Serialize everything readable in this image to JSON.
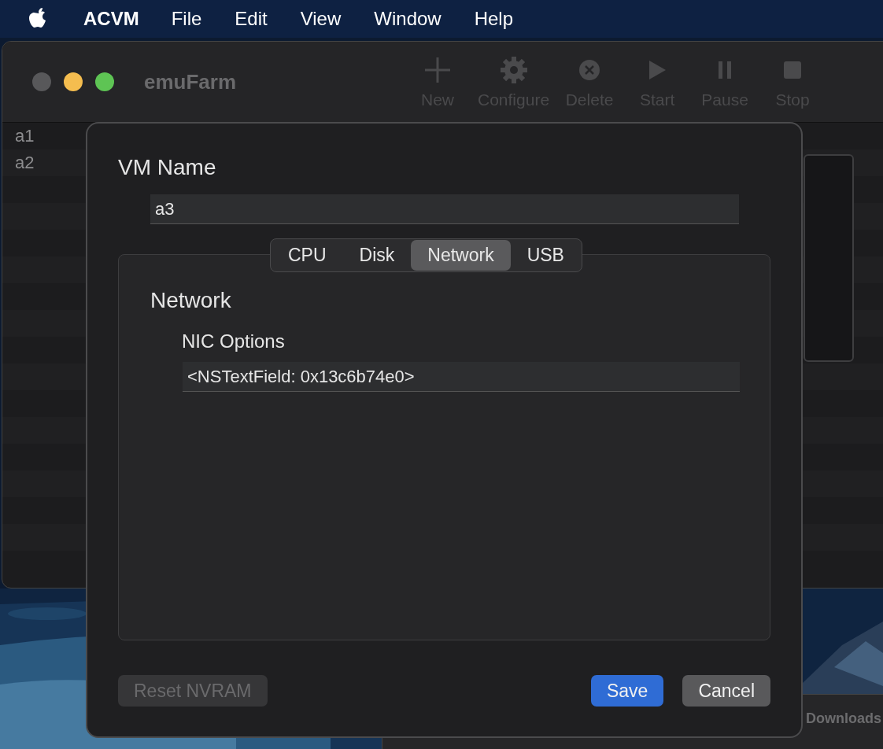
{
  "menu_bar": {
    "app": "ACVM",
    "items": [
      "File",
      "Edit",
      "View",
      "Window",
      "Help"
    ]
  },
  "main_window": {
    "title": "emuFarm",
    "traffic_lights": [
      {
        "color": "#58585a"
      },
      {
        "color": "#f5bd4f"
      },
      {
        "color": "#5ec454"
      }
    ],
    "toolbar": [
      {
        "label": "New",
        "disabled": true
      },
      {
        "label": "Configure",
        "disabled": true
      },
      {
        "label": "Delete",
        "disabled": true
      },
      {
        "label": "Start",
        "disabled": true
      },
      {
        "label": "Pause",
        "disabled": true
      },
      {
        "label": "Stop",
        "disabled": true
      }
    ],
    "vm_list": [
      {
        "name": "a1"
      },
      {
        "name": "a2"
      }
    ]
  },
  "dialog": {
    "name_label": "VM Name",
    "vm_name": "a3",
    "tabs": [
      {
        "label": "CPU",
        "selected": false
      },
      {
        "label": "Disk",
        "selected": false
      },
      {
        "label": "Network",
        "selected": true
      },
      {
        "label": "USB",
        "selected": false
      }
    ],
    "section_title": "Network",
    "field_label": "NIC Options",
    "nic_value": "<NSTextField: 0x13c6b74e0>",
    "buttons": [
      {
        "label": "Reset NVRAM",
        "kind": "secondary",
        "disabled": true
      },
      {
        "label": "Save",
        "kind": "primary",
        "disabled": false
      },
      {
        "label": "Cancel",
        "kind": "secondary",
        "disabled": false
      }
    ]
  },
  "finder_window": {
    "title": "Downloads"
  }
}
